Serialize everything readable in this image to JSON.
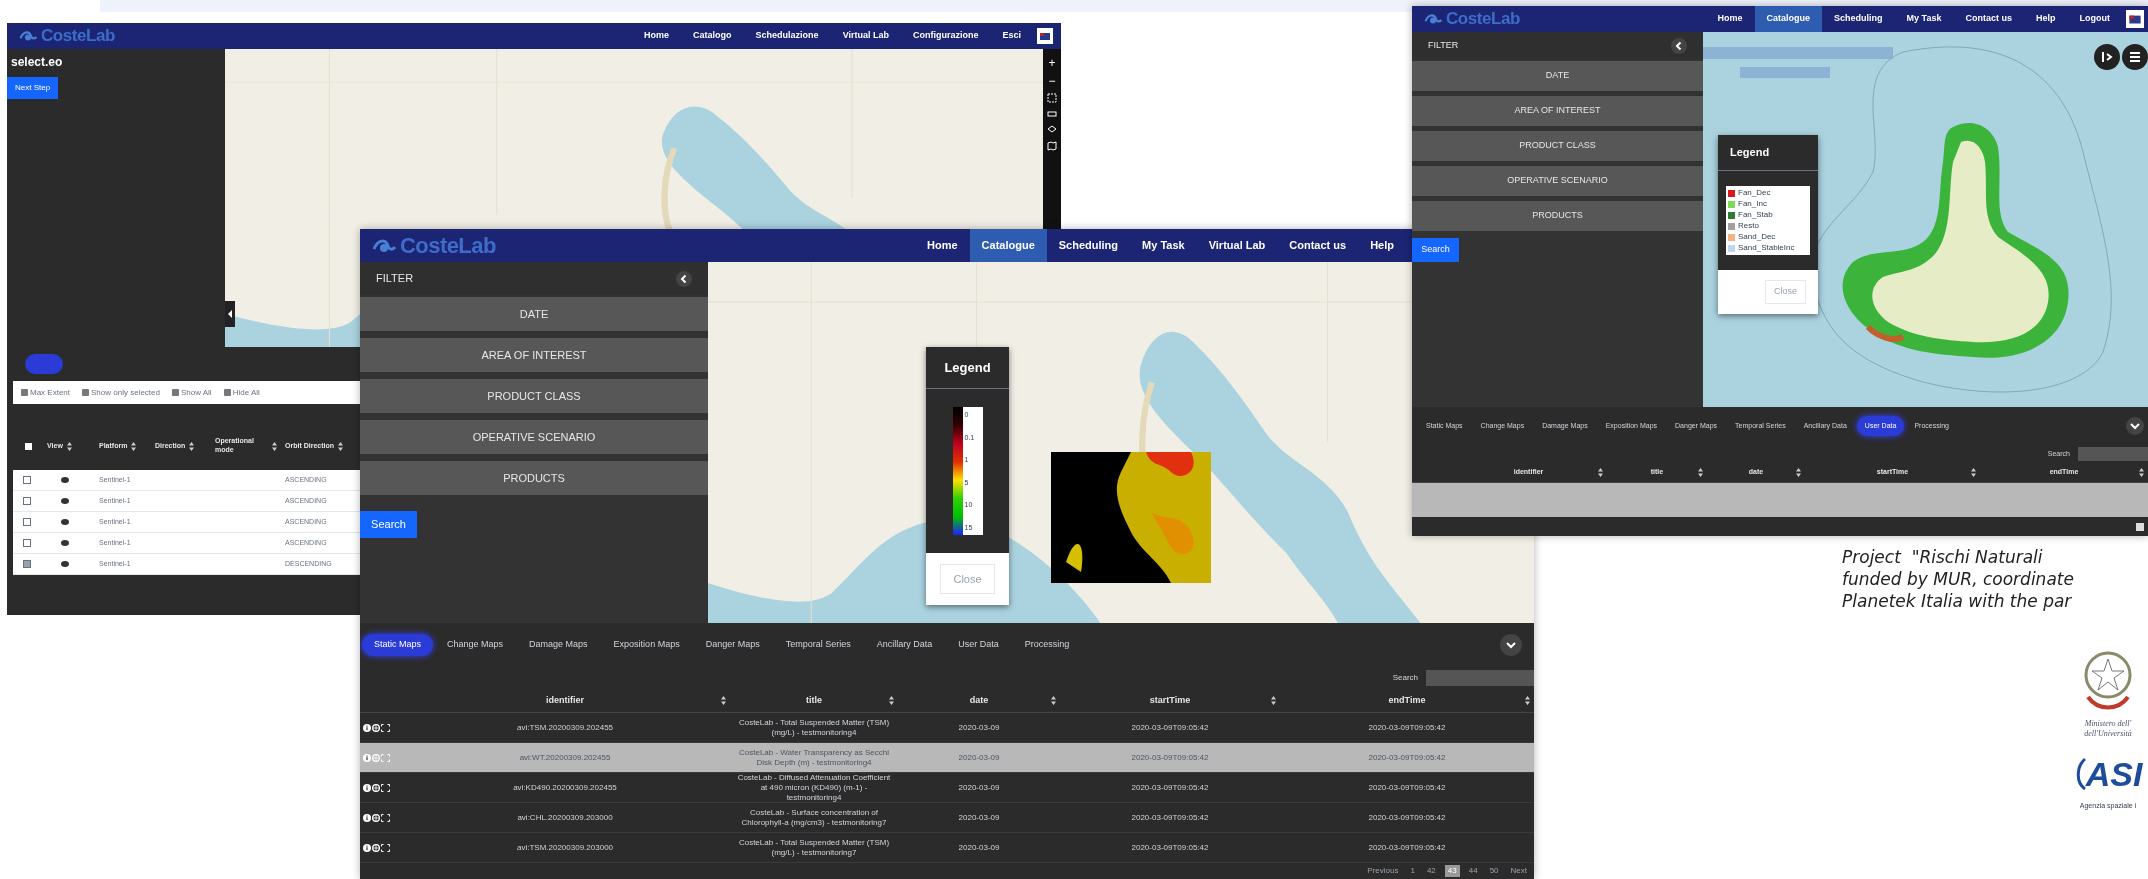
{
  "back_window": {
    "logo": "CosteLab",
    "nav": [
      "Home",
      "Catalogo",
      "Schedulazione",
      "Virtual Lab",
      "Configurazione",
      "Esci"
    ],
    "sidebar_title": "select.eo",
    "next_button": "Next Step",
    "map_controls": [
      "+",
      "−"
    ],
    "toolbar": [
      "Max Extent",
      "Show only selected",
      "Show All",
      "Hide All"
    ],
    "select_all": {
      "checked": false
    },
    "columns": [
      "View",
      "Platform",
      "Direction",
      "Operational mode",
      "Orbit Direction"
    ],
    "rows": [
      {
        "checked": false,
        "platform": "Sentinel-1",
        "orbit": "ASCENDING"
      },
      {
        "checked": false,
        "platform": "Sentinel-1",
        "orbit": "ASCENDING"
      },
      {
        "checked": false,
        "platform": "Sentinel-1",
        "orbit": "ASCENDING"
      },
      {
        "checked": false,
        "platform": "Sentinel-1",
        "orbit": "ASCENDING"
      },
      {
        "checked": true,
        "platform": "Sentinel-1",
        "orbit": "DESCENDING"
      }
    ]
  },
  "main_window": {
    "logo": "CosteLab",
    "nav": [
      {
        "label": "Home",
        "selected": false
      },
      {
        "label": "Catalogue",
        "selected": true
      },
      {
        "label": "Scheduling",
        "selected": false
      },
      {
        "label": "My Task",
        "selected": false
      },
      {
        "label": "Virtual Lab",
        "selected": false
      },
      {
        "label": "Contact us",
        "selected": false
      },
      {
        "label": "Help",
        "selected": false
      }
    ],
    "filter": {
      "title": "FILTER",
      "items": [
        "DATE",
        "AREA OF INTEREST",
        "PRODUCT CLASS",
        "OPERATIVE SCENARIO",
        "PRODUCTS"
      ],
      "search_button": "Search"
    },
    "legend": {
      "title": "Legend",
      "labels": [
        "0",
        "0.1",
        "1",
        "5",
        "10",
        "15"
      ],
      "close": "Close"
    },
    "tabs": [
      {
        "label": "Static Maps",
        "selected": true
      },
      {
        "label": "Change Maps",
        "selected": false
      },
      {
        "label": "Damage Maps",
        "selected": false
      },
      {
        "label": "Exposition Maps",
        "selected": false
      },
      {
        "label": "Danger Maps",
        "selected": false
      },
      {
        "label": "Temporal Series",
        "selected": false
      },
      {
        "label": "Ancillary Data",
        "selected": false
      },
      {
        "label": "User Data",
        "selected": false
      },
      {
        "label": "Processing",
        "selected": false
      }
    ],
    "search_label": "Search",
    "columns": [
      "identifier",
      "title",
      "date",
      "startTime",
      "endTime"
    ],
    "rows": [
      {
        "selected": false,
        "identifier": "avi:TSM.20200309.202455",
        "title": "CosteLab - Total Suspended Matter (TSM) (mg/L) - testmonitoring4",
        "date": "2020-03-09",
        "start": "2020-03-09T09:05:42",
        "end": "2020-03-09T09:05:42"
      },
      {
        "selected": true,
        "identifier": "avi:WT.20200309.202455",
        "title": "CosteLab - Water Transparency as Secchi Disk Depth (m) - testmonitoring4",
        "date": "2020-03-09",
        "start": "2020-03-09T09:05:42",
        "end": "2020-03-09T09:05:42"
      },
      {
        "selected": false,
        "identifier": "avi:KD490.20200309.202455",
        "title": "CosteLab - Diffused Attenuation Coefficient at 490 micron (KD490) (m-1) - testmonitoring4",
        "date": "2020-03-09",
        "start": "2020-03-09T09:05:42",
        "end": "2020-03-09T09:05:42"
      },
      {
        "selected": false,
        "identifier": "avi:CHL.20200309.203000",
        "title": "CosteLab - Surface concentration of Chlorophyll-a (mg/cm3) - testmonitoring7",
        "date": "2020-03-09",
        "start": "2020-03-09T09:05:42",
        "end": "2020-03-09T09:05:42"
      },
      {
        "selected": false,
        "identifier": "avi:TSM.20200309.203000",
        "title": "CosteLab - Total Suspended Matter (TSM) (mg/L) - testmonitoring7",
        "date": "2020-03-09",
        "start": "2020-03-09T09:05:42",
        "end": "2020-03-09T09:05:42"
      }
    ],
    "pagination": [
      {
        "label": "Previous",
        "selected": false
      },
      {
        "label": "1",
        "selected": false
      },
      {
        "label": "42",
        "selected": false
      },
      {
        "label": "43",
        "selected": true
      },
      {
        "label": "44",
        "selected": false
      },
      {
        "label": "50",
        "selected": false
      },
      {
        "label": "Next",
        "selected": false
      }
    ]
  },
  "right_window": {
    "logo": "CosteLab",
    "nav": [
      {
        "label": "Home",
        "selected": false
      },
      {
        "label": "Catalogue",
        "selected": true
      },
      {
        "label": "Scheduling",
        "selected": false
      },
      {
        "label": "My Task",
        "selected": false
      },
      {
        "label": "Contact us",
        "selected": false
      },
      {
        "label": "Help",
        "selected": false
      },
      {
        "label": "Logout",
        "selected": false
      }
    ],
    "filter": {
      "title": "FILTER",
      "items": [
        "DATE",
        "AREA OF INTEREST",
        "PRODUCT CLASS",
        "OPERATIVE SCENARIO",
        "PRODUCTS"
      ],
      "search_button": "Search"
    },
    "legend": {
      "title": "Legend",
      "close": "Close",
      "items": [
        {
          "label": "Fan_Dec",
          "color": "#d7191c"
        },
        {
          "label": "Fan_Inc",
          "color": "#7ed957"
        },
        {
          "label": "Fan_Stab",
          "color": "#2e7d32"
        },
        {
          "label": "Resto",
          "color": "#a0a0a0"
        },
        {
          "label": "Sand_Dec",
          "color": "#f4b183"
        },
        {
          "label": "Sand_StableInc",
          "color": "#bdd7ee"
        }
      ]
    },
    "tabs": [
      {
        "label": "Static Maps",
        "selected": false
      },
      {
        "label": "Change Maps",
        "selected": false
      },
      {
        "label": "Damage Maps",
        "selected": false
      },
      {
        "label": "Exposition Maps",
        "selected": false
      },
      {
        "label": "Danger Maps",
        "selected": false
      },
      {
        "label": "Temporal Series",
        "selected": false
      },
      {
        "label": "Ancillary Data",
        "selected": false
      },
      {
        "label": "User Data",
        "selected": true
      },
      {
        "label": "Processing",
        "selected": false
      }
    ],
    "search_label": "Search",
    "columns": [
      "identifier",
      "title",
      "date",
      "startTime",
      "endTime"
    ]
  },
  "caption": {
    "lines": [
      "Project  \"Rischi Naturali",
      "funded by MUR, coordinate",
      "Planetek Italia with the par"
    ]
  },
  "logos": {
    "ministry_lines": [
      "Ministero dell'",
      "dell'Università"
    ],
    "agency_mark": "ASI",
    "agency_name": "Agenzia spaziale i"
  }
}
